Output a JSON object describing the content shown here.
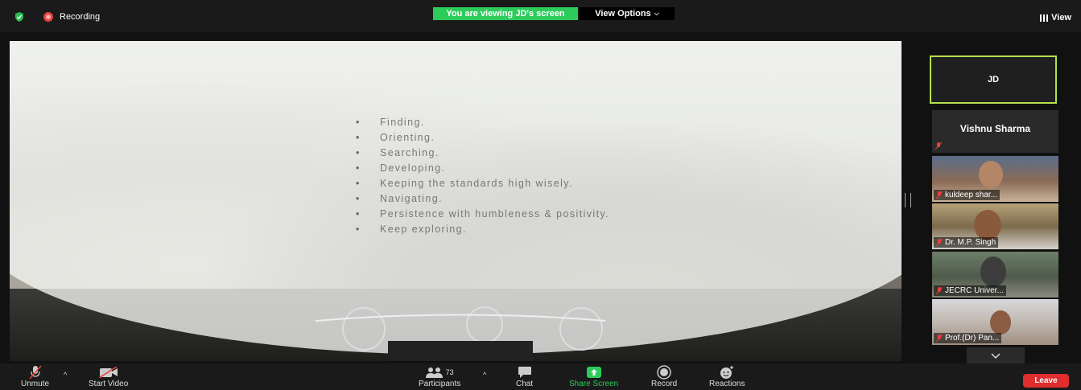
{
  "topbar": {
    "recording_label": "Recording",
    "viewing_banner": "You are viewing JD's screen",
    "view_options_label": "View Options",
    "view_label": "View",
    "banner_color": "#2dcc5a"
  },
  "shared_screen": {
    "bullets": [
      "Finding.",
      "Orienting.",
      "Searching.",
      "Developing.",
      "Keeping the standards high wisely.",
      "Navigating.",
      "Persistence with humbleness & positivity.",
      "Keep exploring."
    ]
  },
  "participants_panel": {
    "active_speaker": "JD",
    "tiles": [
      {
        "name": "Vishnu Sharma"
      },
      {
        "name": "kuldeep shar..."
      },
      {
        "name": "Dr. M.P. Singh"
      },
      {
        "name": "JECRC Univer..."
      },
      {
        "name": "Prof.(Dr) Pan..."
      }
    ]
  },
  "toolbar": {
    "unmute_label": "Unmute",
    "start_video_label": "Start Video",
    "participants_label": "Participants",
    "participants_count": "73",
    "chat_label": "Chat",
    "share_screen_label": "Share Screen",
    "record_label": "Record",
    "reactions_label": "Reactions",
    "leave_label": "Leave"
  }
}
